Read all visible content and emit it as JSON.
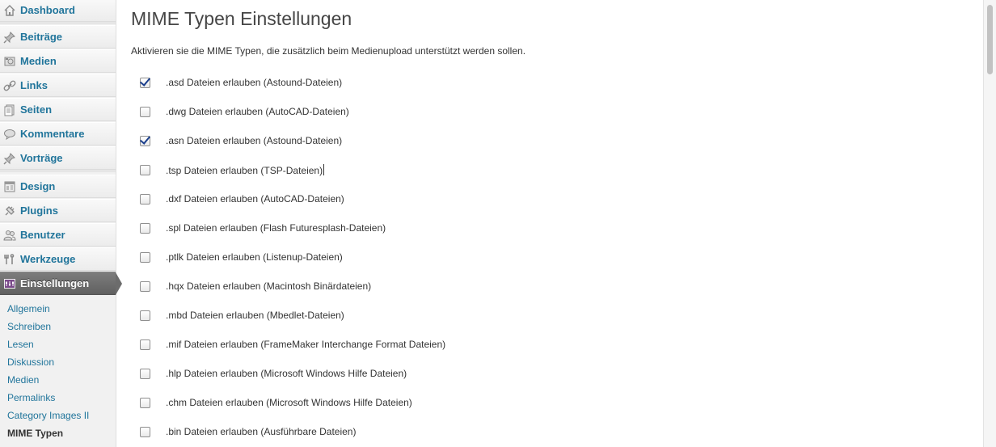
{
  "sidebar": {
    "items": [
      {
        "label": "Dashboard",
        "icon": "dashboard-icon"
      },
      {
        "label": "Beiträge",
        "icon": "pin-icon"
      },
      {
        "label": "Medien",
        "icon": "media-icon"
      },
      {
        "label": "Links",
        "icon": "link-icon"
      },
      {
        "label": "Seiten",
        "icon": "pages-icon"
      },
      {
        "label": "Kommentare",
        "icon": "comment-icon"
      },
      {
        "label": "Vorträge",
        "icon": "pin-icon"
      },
      {
        "label": "Design",
        "icon": "design-icon"
      },
      {
        "label": "Plugins",
        "icon": "plugin-icon"
      },
      {
        "label": "Benutzer",
        "icon": "users-icon"
      },
      {
        "label": "Werkzeuge",
        "icon": "tools-icon"
      },
      {
        "label": "Einstellungen",
        "icon": "settings-icon"
      }
    ],
    "submenu": [
      {
        "label": "Allgemein"
      },
      {
        "label": "Schreiben"
      },
      {
        "label": "Lesen"
      },
      {
        "label": "Diskussion"
      },
      {
        "label": "Medien"
      },
      {
        "label": "Permalinks"
      },
      {
        "label": "Category Images II"
      },
      {
        "label": "MIME Typen"
      }
    ]
  },
  "main": {
    "title": "MIME Typen Einstellungen",
    "intro": "Aktivieren sie die MIME Typen, die zusätzlich beim Medienupload unterstützt werden sollen.",
    "options": [
      {
        "label": ".asd Dateien erlauben (Astound-Dateien)",
        "checked": true
      },
      {
        "label": ".dwg Dateien erlauben (AutoCAD-Dateien)",
        "checked": false
      },
      {
        "label": ".asn Dateien erlauben (Astound-Dateien)",
        "checked": true
      },
      {
        "label": ".tsp Dateien erlauben (TSP-Dateien)",
        "checked": false
      },
      {
        "label": ".dxf Dateien erlauben (AutoCAD-Dateien)",
        "checked": false
      },
      {
        "label": ".spl Dateien erlauben (Flash Futuresplash-Dateien)",
        "checked": false
      },
      {
        "label": ".ptlk Dateien erlauben (Listenup-Dateien)",
        "checked": false
      },
      {
        "label": ".hqx Dateien erlauben (Macintosh Binärdateien)",
        "checked": false
      },
      {
        "label": ".mbd Dateien erlauben (Mbedlet-Dateien)",
        "checked": false
      },
      {
        "label": ".mif Dateien erlauben (FrameMaker Interchange Format Dateien)",
        "checked": false
      },
      {
        "label": ".hlp Dateien erlauben (Microsoft Windows Hilfe Dateien)",
        "checked": false
      },
      {
        "label": ".chm Dateien erlauben (Microsoft Windows Hilfe Dateien)",
        "checked": false
      },
      {
        "label": ".bin Dateien erlauben (Ausführbare Dateien)",
        "checked": false
      }
    ]
  },
  "colors": {
    "link": "#21759b",
    "active_menu": "#6c6c6c",
    "checkmark": "#1a3e8c"
  }
}
